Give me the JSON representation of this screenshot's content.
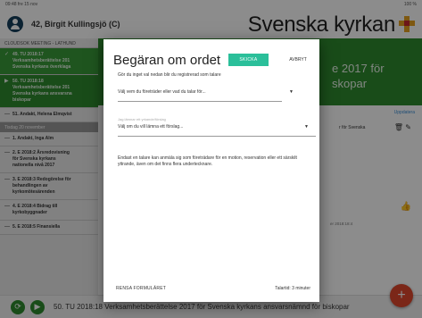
{
  "status_bar": {
    "left": "09:48 fre 15 nov",
    "right": "100 %"
  },
  "header": {
    "user": "42, Birgit Kullingsjö (C)",
    "brand": "Svenska kyrkan"
  },
  "sidebar": {
    "meeting": "CLOUDSOK MEETING - LATHUND",
    "items": [
      {
        "title": "49. TU 2018:17",
        "lines": [
          "Verksamhetsberättelse 201",
          "Svenska kyrkans överklaga"
        ],
        "style": "done"
      },
      {
        "title": "50. TU 2018:18",
        "lines": [
          "Verksamhetsberättelse 201",
          "Svenska kyrkans ansvarsna",
          "biskopar"
        ],
        "style": "active"
      },
      {
        "title": "51. Andakt, Helena Elmqvist",
        "lines": [],
        "style": "normal"
      }
    ],
    "day_header": "Tisdag 20 november",
    "items2": [
      {
        "title": "1. Andakt, Inga Alm",
        "lines": []
      },
      {
        "title": "2. E 2018:2 Årsredovisning",
        "lines": [
          "för Svenska kyrkans",
          "nationella nivå 2017"
        ]
      },
      {
        "title": "3. E 2018:3 Redogörelse för",
        "lines": [
          "behandlingen av",
          "kyrkomötesärenden"
        ]
      },
      {
        "title": "4. E 2018:4 Bidrag till",
        "lines": [
          "kyrkobyggnader"
        ]
      },
      {
        "title": "5. E 2018:5 Finansiella",
        "lines": []
      }
    ]
  },
  "main": {
    "banner_line1": "e 2017 för",
    "banner_line2": "skopar",
    "update_link": "Uppdatera",
    "row1": "r för Svenska",
    "row2": "er 2018:18:4"
  },
  "bottom_bar": {
    "text": "50. TU 2018:18 Verksamhetsberättelse 2017 för Svenska kyrkans ansvarsnämnd för biskopar"
  },
  "dialog": {
    "title": "Begäran om ordet",
    "send_label": "SKICKA",
    "cancel_label": "AVBRYT",
    "instruction": "Gör du inget val nedan blir du registrerad som talare",
    "select1_value": "Välj vem du företräder eller vad du talar för...",
    "select2_label": "Jag lämnar ett yrkande/förslag",
    "select2_value": "Välj om du vill lämna ett förslag...",
    "info": "Endast en talare kan anmäla sig som företrädare för en motion, reservation eller ett särskilt yttrande, även om det finns flera undertecknare.",
    "reset_label": "RENSA FORMULÄRET",
    "speak_time": "Talartid: 3 minuter"
  },
  "colors": {
    "green": "#2e8b2e",
    "teal": "#2bbf9a",
    "fab": "#e0482c"
  }
}
